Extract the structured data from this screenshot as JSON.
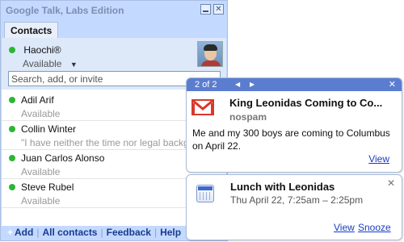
{
  "window": {
    "title": "Google Talk, Labs Edition",
    "minimize_icon": "minimize-icon",
    "close_icon": "close-icon"
  },
  "tabs": [
    {
      "label": "Contacts",
      "active": true
    }
  ],
  "me": {
    "name": "Haochi®",
    "status": "Available",
    "status_color": "#2db534"
  },
  "search": {
    "placeholder": "Search, add, or invite",
    "value": ""
  },
  "contacts": [
    {
      "name": "Adil Arif",
      "status": "Available"
    },
    {
      "name": "Collin Winter",
      "status": "\"I have neither the time nor legal backg"
    },
    {
      "name": "Juan Carlos Alonso",
      "status": "Available"
    },
    {
      "name": "Steve Rubel",
      "status": "Available"
    }
  ],
  "footer": {
    "add": "Add",
    "all_contacts": "All contacts",
    "feedback": "Feedback",
    "help": "Help"
  },
  "notification_email": {
    "counter": "2 of 2",
    "title": "King Leonidas Coming to Co...",
    "sender": "nospam",
    "body": "Me and my 300 boys are coming to Columbus on April 22.",
    "action_view": "View",
    "icon": "gmail-icon",
    "header_color": "#5b7dd0"
  },
  "notification_event": {
    "title": "Lunch with Leonidas",
    "time": "Thu April 22, 7:25am – 2:25pm",
    "action_view": "View",
    "action_snooze": "Snooze",
    "icon": "calendar-icon"
  },
  "colors": {
    "window_bg": "#c3d9ff",
    "link": "#1a3bc4",
    "online": "#2db534"
  }
}
